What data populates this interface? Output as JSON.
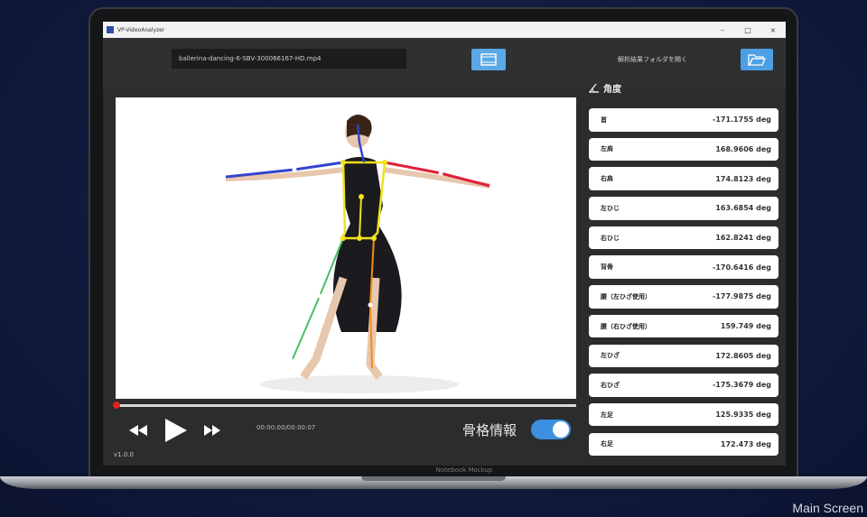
{
  "window": {
    "title": "VP-VideoAnalyzer",
    "controls": [
      "–",
      "□",
      "×"
    ]
  },
  "toolbar": {
    "filename": "ballerina-dancing-6-SBV-300066167-HD.mp4",
    "open_results_label": "解析結果フォルダを開く"
  },
  "icons": {
    "video": "film-icon",
    "folder": "folder-open-icon",
    "rewind": "rewind-icon",
    "play": "play-icon",
    "forward": "fast-forward-icon",
    "angle": "angle-icon"
  },
  "player": {
    "time": "00:00:00/00:00:07",
    "skeleton_label": "骨格情報",
    "skeleton_enabled": true,
    "progress": 0
  },
  "panel": {
    "title": "角度",
    "angles": [
      {
        "label": "首",
        "value": "-171.1755 deg"
      },
      {
        "label": "左肩",
        "value": "168.9606 deg"
      },
      {
        "label": "右肩",
        "value": "174.8123 deg"
      },
      {
        "label": "左ひじ",
        "value": "163.6854 deg"
      },
      {
        "label": "右ひじ",
        "value": "162.8241 deg"
      },
      {
        "label": "背骨",
        "value": "-170.6416 deg"
      },
      {
        "label": "腰（左ひざ使用）",
        "value": "-177.9875 deg"
      },
      {
        "label": "腰（右ひざ使用）",
        "value": "159.749 deg"
      },
      {
        "label": "左ひざ",
        "value": "172.8605 deg"
      },
      {
        "label": "右ひざ",
        "value": "-175.3679 deg"
      },
      {
        "label": "左足",
        "value": "125.9335 deg"
      },
      {
        "label": "右足",
        "value": "172.473 deg"
      }
    ]
  },
  "version": "v1.0.0",
  "mockup_label": "Notebook Mockup",
  "caption": "Main Screen",
  "colors": {
    "accent": "#4d9fe4",
    "seek": "#e02020",
    "skeleton_left": "#3344cc",
    "skeleton_right": "#e0203a",
    "skeleton_torso": "#f2e21a"
  }
}
